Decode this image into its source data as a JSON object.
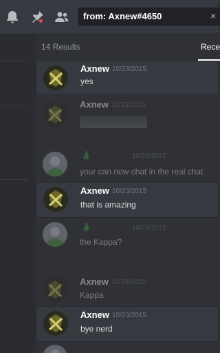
{
  "toolbar": {
    "search_value": "from: Axnew#4650",
    "clear": "×"
  },
  "results_header": {
    "count": "14 Results",
    "tab_label": "Rece"
  },
  "messages": [
    {
      "author": "Axnew",
      "timestamp": "10/23/2015",
      "text": "yes"
    },
    {
      "author": "Axnew",
      "timestamp": "10/23/2015",
      "text": ""
    },
    {
      "author": "",
      "badge": "🎄",
      "timestamp": "10/23/2015",
      "text": "your can now chat in the real chat"
    },
    {
      "author": "Axnew",
      "timestamp": "10/23/2015",
      "text": "that is amazing"
    },
    {
      "author": "",
      "badge": "🎄",
      "timestamp": "10/23/2015",
      "text": "the Kappa?"
    },
    {
      "author": "Axnew",
      "timestamp": "10/23/2015",
      "text": "Kappa"
    },
    {
      "author": "Axnew",
      "timestamp": "10/23/2015",
      "text": "bye nerd"
    },
    {
      "author": "",
      "timestamp": "",
      "text": ""
    }
  ],
  "colors": {
    "background": "#2f3136",
    "hit_card": "#36393f",
    "author_purple": "#9b59b6",
    "notification_dot": "#f04747"
  },
  "icons": [
    "bell-icon",
    "pin-icon",
    "members-icon",
    "close-icon"
  ]
}
